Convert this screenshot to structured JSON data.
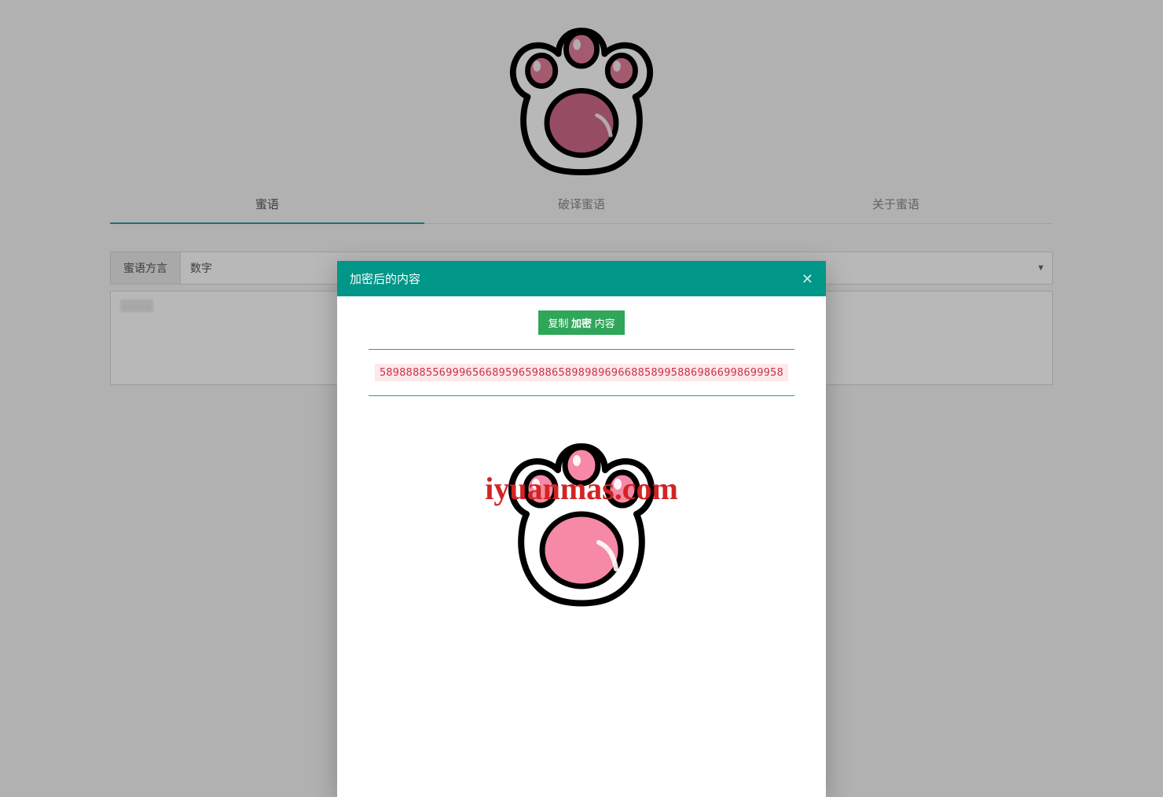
{
  "tabs": {
    "items": [
      {
        "label": "蜜语",
        "active": true
      },
      {
        "label": "破译蜜语",
        "active": false
      },
      {
        "label": "关于蜜语",
        "active": false
      }
    ]
  },
  "form": {
    "dialect_label": "蜜语方言",
    "dialect_value": "数字",
    "textarea_value": "······"
  },
  "modal": {
    "title": "加密后的内容",
    "copy_prefix": "复制",
    "copy_mid": "加密",
    "copy_suffix": "内容",
    "cipher_text": "5898888556999656689596598865898989696688589958869866998699958"
  },
  "watermark": "iyuanmas.com"
}
